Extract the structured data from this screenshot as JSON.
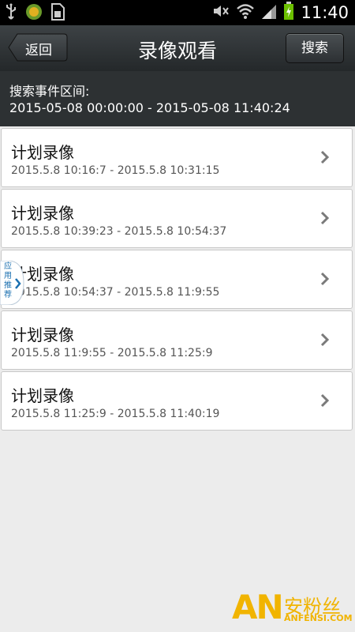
{
  "status_bar": {
    "time": "11:40",
    "icons": [
      "usb-icon",
      "app-notification-icon",
      "sim-icon",
      "mute-icon",
      "wifi-icon",
      "signal-icon",
      "battery-charging-icon"
    ]
  },
  "header": {
    "back_label": "返回",
    "title": "录像观看",
    "search_label": "搜索"
  },
  "range": {
    "label": "搜索事件区间:",
    "value": "2015-05-08 00:00:00 - 2015-05-08 11:40:24"
  },
  "recordings": [
    {
      "title": "计划录像",
      "time": "2015.5.8 10:16:7 - 2015.5.8 10:31:15"
    },
    {
      "title": "计划录像",
      "time": "2015.5.8 10:39:23 - 2015.5.8 10:54:37"
    },
    {
      "title": "计划录像",
      "time": "2015.5.8 10:54:37 - 2015.5.8 11:9:55"
    },
    {
      "title": "计划录像",
      "time": "2015.5.8 11:9:55 - 2015.5.8 11:25:9"
    },
    {
      "title": "计划录像",
      "time": "2015.5.8 11:25:9 - 2015.5.8 11:40:19"
    }
  ],
  "floating_tab": {
    "label": "应用推荐"
  },
  "watermark": {
    "logo": "AN",
    "name": "安粉丝",
    "url": "ANFENSI.COM"
  },
  "colors": {
    "accent": "#f1b400",
    "titlebar": "#2e3235",
    "link": "#1a6fb0"
  }
}
